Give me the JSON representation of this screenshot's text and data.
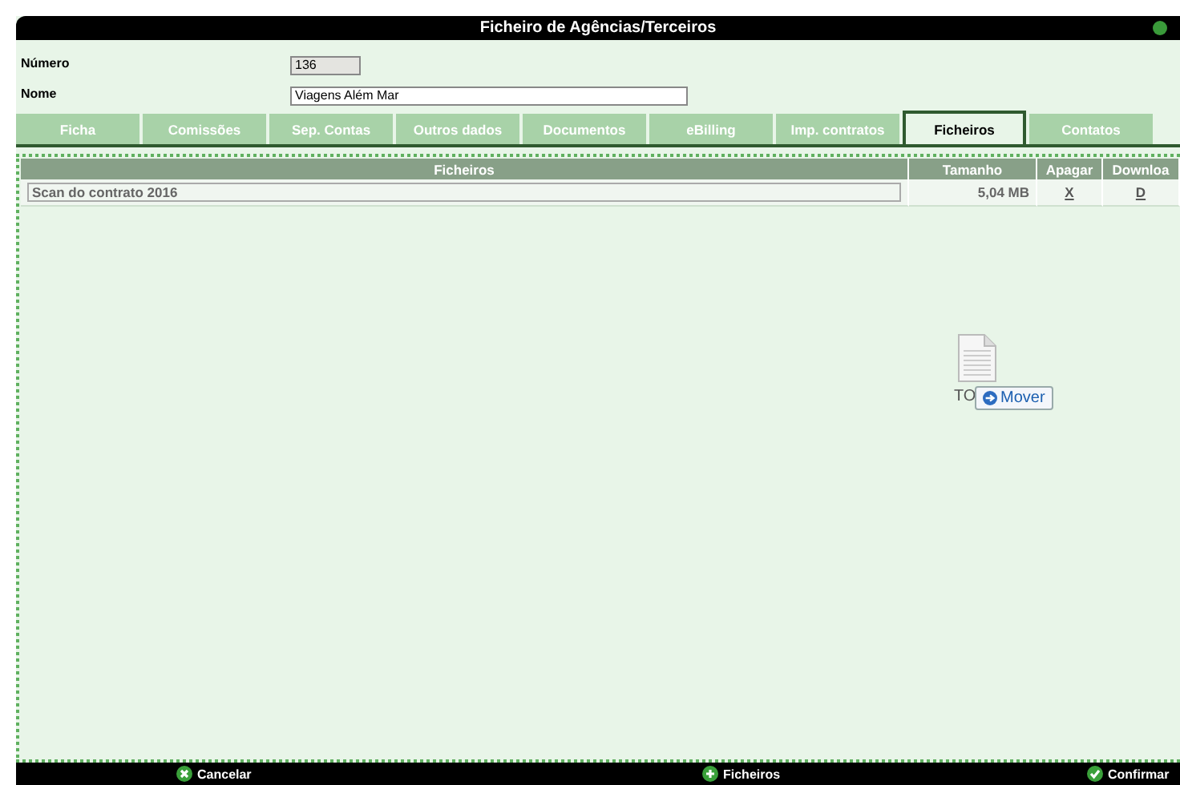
{
  "window": {
    "title": "Ficheiro de Agências/Terceiros"
  },
  "fields": [
    {
      "label": "Número",
      "value": "136",
      "disabled": true
    },
    {
      "label": "Nome",
      "value": "Viagens Além Mar",
      "disabled": false
    }
  ],
  "tabs": [
    {
      "label": "Ficha",
      "selected": false
    },
    {
      "label": "Comissões",
      "selected": false
    },
    {
      "label": "Sep. Contas",
      "selected": false
    },
    {
      "label": "Outros dados",
      "selected": false
    },
    {
      "label": "Documentos",
      "selected": false
    },
    {
      "label": "eBilling",
      "selected": false
    },
    {
      "label": "Imp. contratos",
      "selected": false
    },
    {
      "label": "Ficheiros",
      "selected": true
    },
    {
      "label": "Contatos",
      "selected": false
    }
  ],
  "table": {
    "columns": [
      "Ficheiros",
      "Tamanho",
      "Apagar",
      "Downloa"
    ],
    "rows": [
      {
        "name": "Scan do contrato 2016",
        "size": "5,04 MB",
        "delete": "X",
        "download": "D"
      }
    ]
  },
  "drag": {
    "file_label": "TO",
    "tooltip": "Mover"
  },
  "footer": {
    "buttons": [
      {
        "label": "Cancelar",
        "kind": "cancel"
      },
      {
        "label": "Ficheiros",
        "kind": "add"
      },
      {
        "label": "Confirmar",
        "kind": "confirm"
      }
    ]
  }
}
